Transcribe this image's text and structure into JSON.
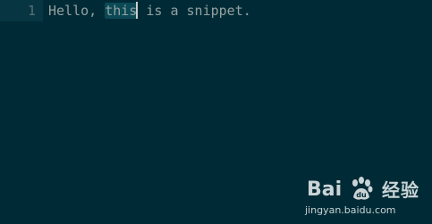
{
  "editor": {
    "line_number": "1",
    "code_before": "Hello, ",
    "code_highlight": "this",
    "code_after": " is a snippet."
  },
  "watermark": {
    "brand_left": "Bai",
    "brand_right": "经验",
    "url": "jingyan.baidu.com"
  },
  "colors": {
    "background": "#002b36",
    "gutter": "#073642",
    "text": "#93a1a1",
    "line_number": "#586e75",
    "highlight": "#0b4a55"
  },
  "icons": {
    "watermark_logo": "paw-icon"
  }
}
